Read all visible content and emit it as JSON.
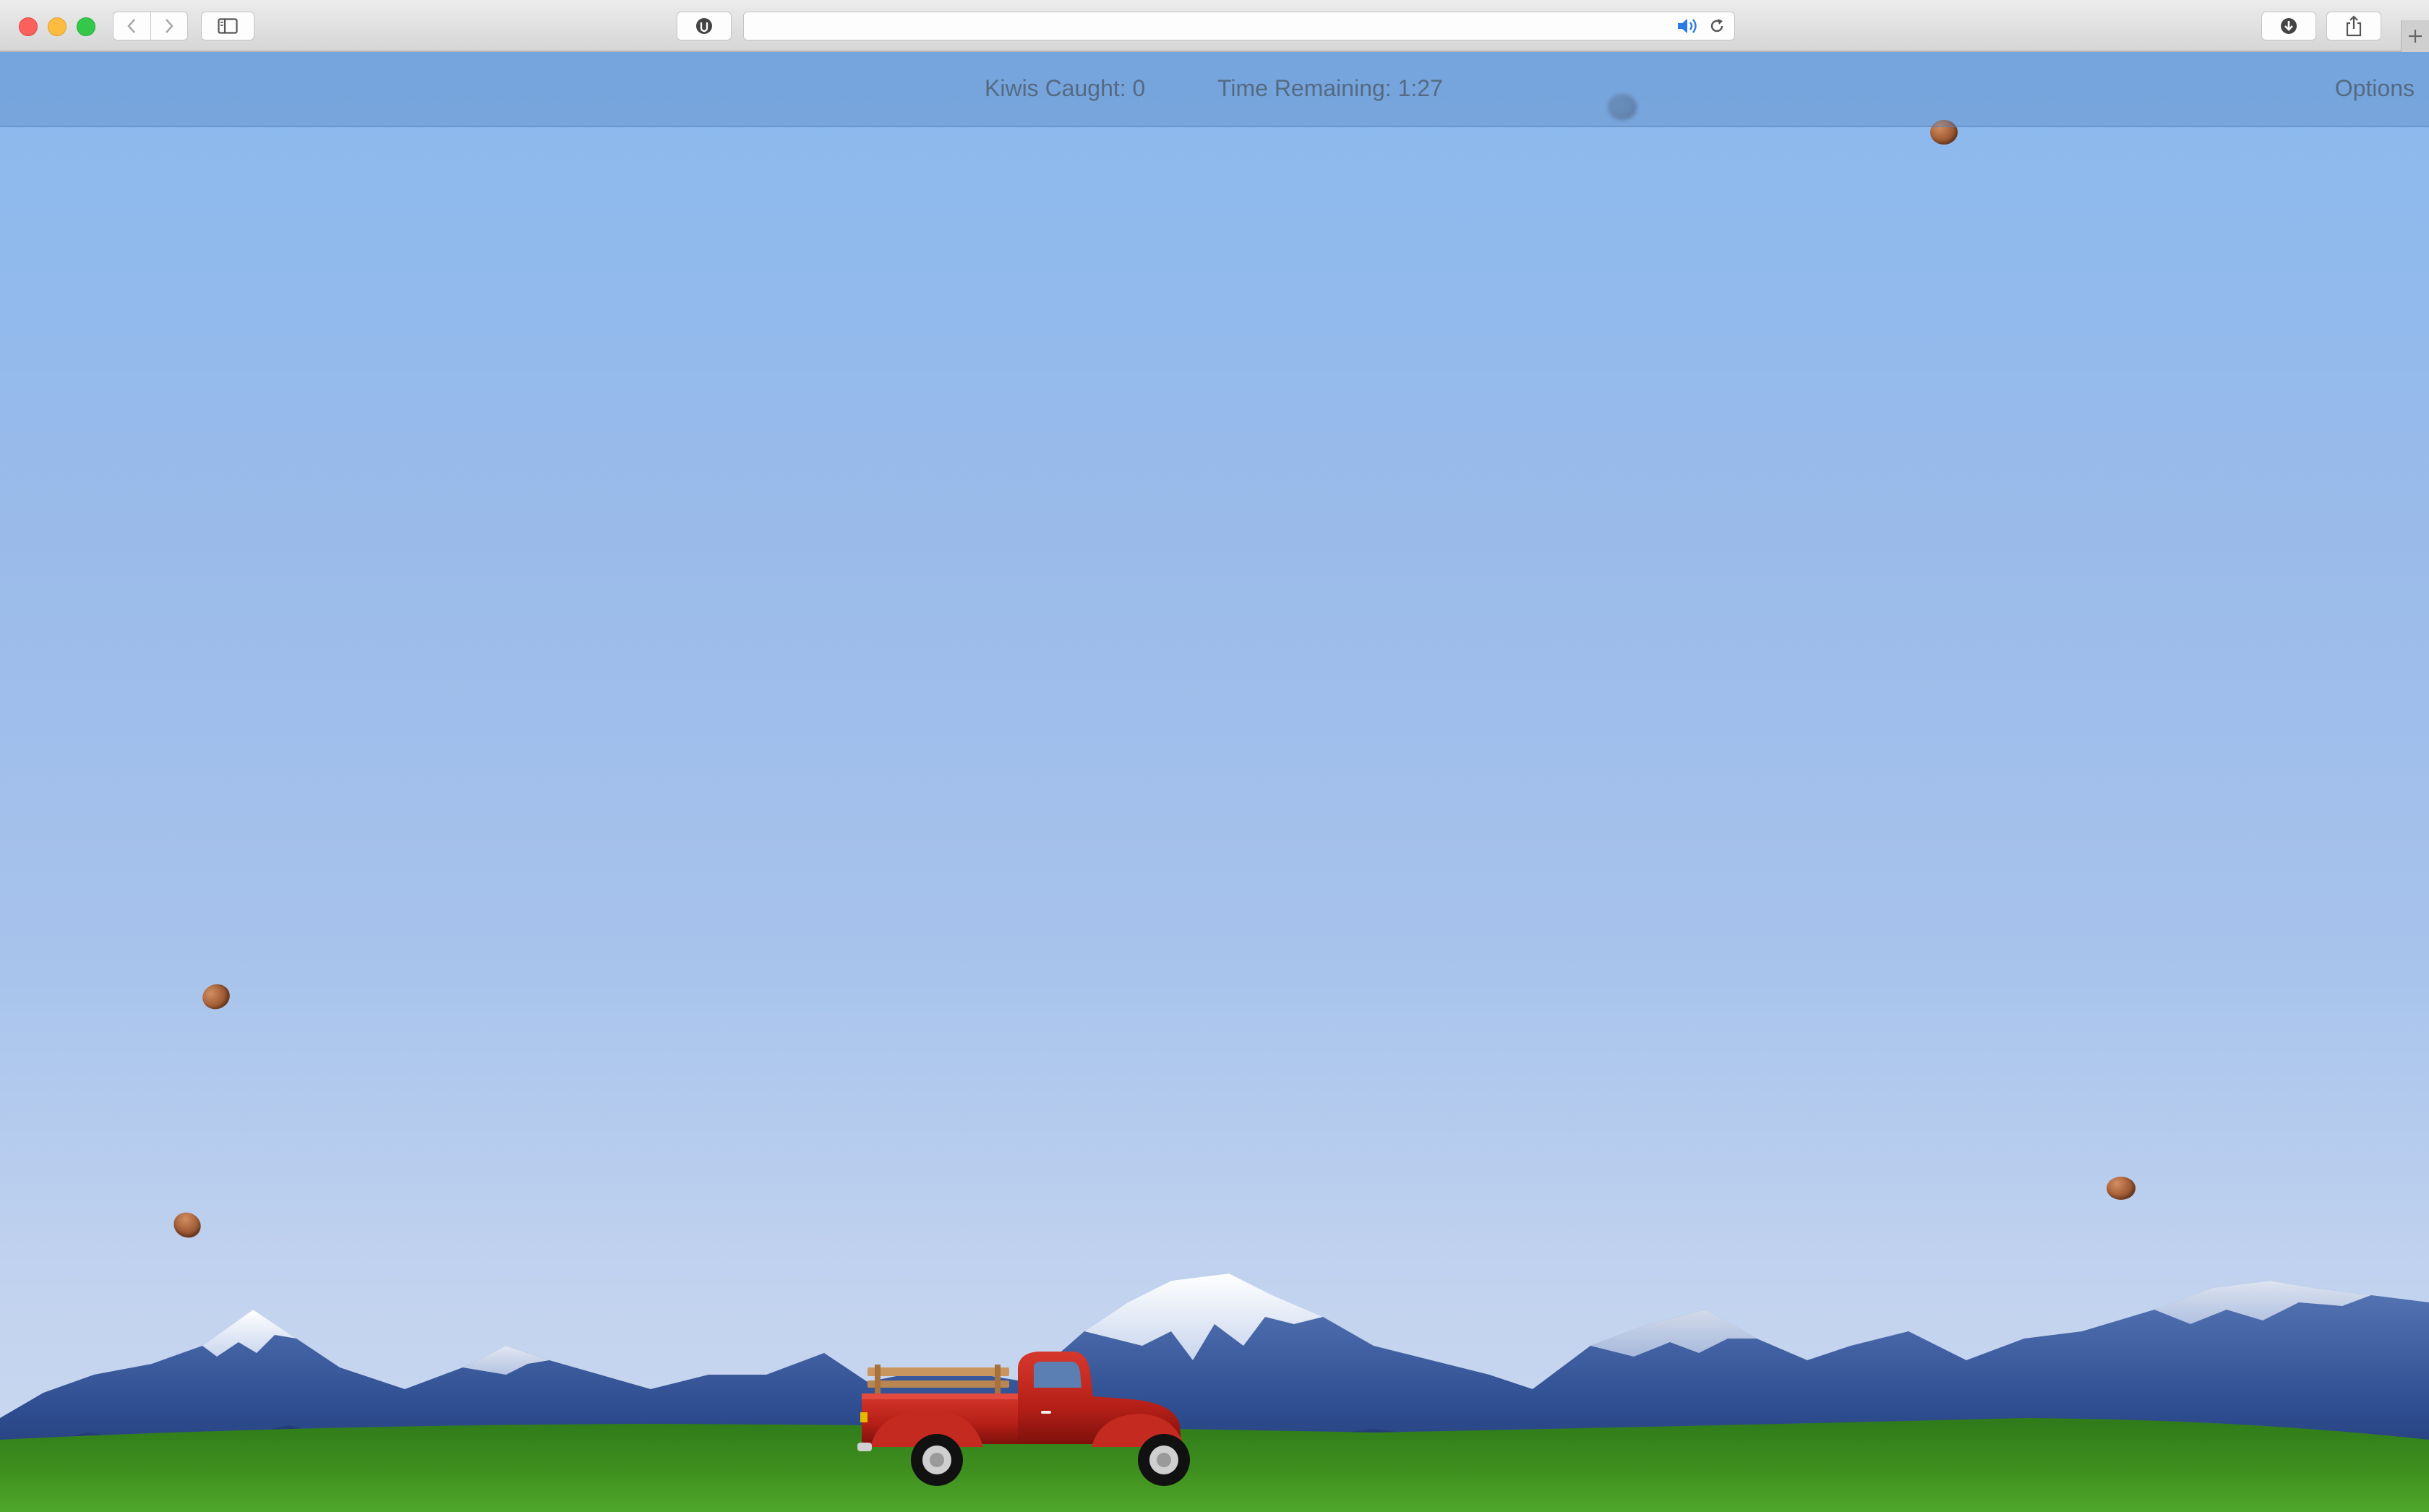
{
  "browser": {
    "url": "",
    "icons": {
      "back": "chevron-left-icon",
      "forward": "chevron-right-icon",
      "sidebar": "sidebar-icon",
      "privacy": "privacy-shield-icon",
      "audio": "speaker-icon",
      "reload": "reload-icon",
      "download": "download-icon",
      "share": "share-icon",
      "new_tab": "plus-icon"
    },
    "audio_icon_color": "#2a7be4"
  },
  "game": {
    "hud": {
      "kiwis_caught": "Kiwis Caught: 0",
      "time_remaining": "Time Remaining: 1:27",
      "options_label": "Options"
    },
    "scene": {
      "sky_top_color": "#8ab9ee",
      "sky_bottom_color": "#cdd9ef",
      "grass_color": "#3d8d1e",
      "truck_color": "#b51f17",
      "kiwi_color": "#a8633b"
    }
  }
}
